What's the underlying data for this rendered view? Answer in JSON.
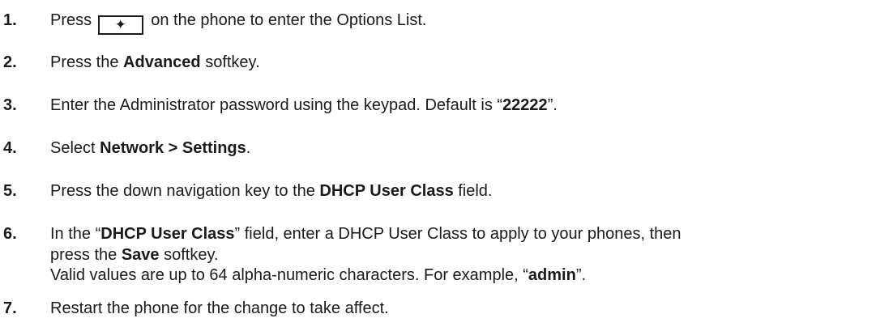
{
  "steps": [
    {
      "number": "1.",
      "before": "Press",
      "key_icon": "✦",
      "key_name": "gear-icon",
      "after": "on the phone to enter the Options List."
    },
    {
      "number": "2.",
      "a": "Press the ",
      "b": "Advanced",
      "c": " softkey."
    },
    {
      "number": "3.",
      "a": "Enter the Administrator password using the keypad. Default is “",
      "b": "22222",
      "c": "”."
    },
    {
      "number": "4.",
      "a": "Select ",
      "b": "Network > Settings",
      "c": "."
    },
    {
      "number": "5.",
      "a": "Press the down navigation key to the ",
      "b": "DHCP User Class",
      "c": " field."
    },
    {
      "number": "6.",
      "line1_a": "In the “",
      "line1_b": "DHCP User Class",
      "line1_c": "” field, enter a DHCP User Class to apply to your phones, then",
      "line2_a": "press the ",
      "line2_b": "Save",
      "line2_c": " softkey.",
      "line3_a": "Valid values are up to 64 alpha-numeric characters. For example, “",
      "line3_b": "admin",
      "line3_c": "”."
    },
    {
      "number": "7.",
      "a": "Restart the phone for the change to take affect."
    }
  ]
}
